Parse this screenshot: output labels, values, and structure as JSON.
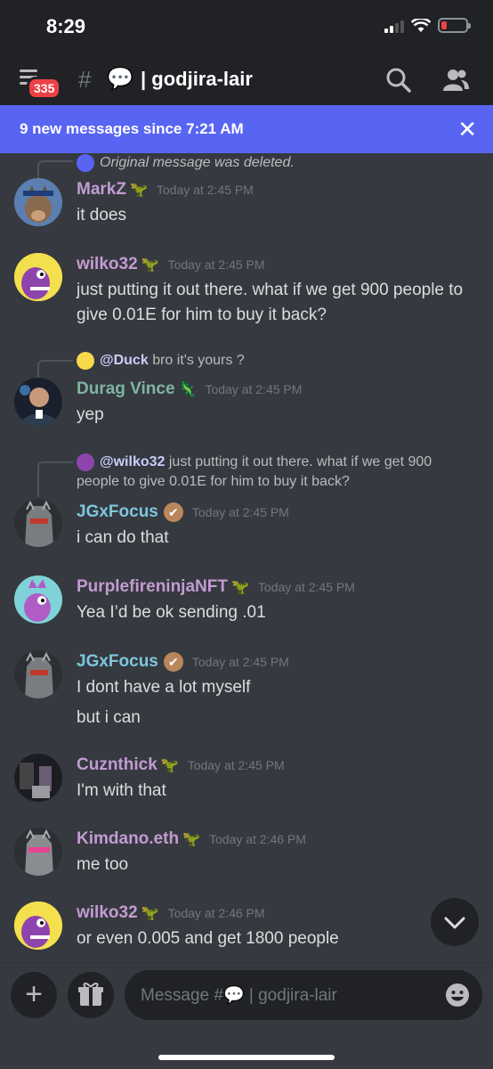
{
  "status": {
    "time": "8:29"
  },
  "header": {
    "badge": "335",
    "hash": "#",
    "channel_emoji": "💬",
    "channel": "| godjira-lair"
  },
  "banner": {
    "text": "9 new messages since 7:21 AM",
    "close": "✕"
  },
  "messages": [
    {
      "deleted": "Original message was deleted.",
      "author": "MarkZ",
      "author_color": "#c39bd3",
      "time": "Today at 2:45 PM",
      "lines": [
        "it does"
      ]
    },
    {
      "author": "wilko32",
      "author_color": "#c39bd3",
      "time": "Today at 2:45 PM",
      "lines": [
        "just putting it out there. what if we get 900 people to give 0.01E for him to buy it back?"
      ]
    },
    {
      "reply_to": "@Duck",
      "reply_text": "bro it's yours ?",
      "author": "Durag Vince",
      "author_color": "#7fb5a0",
      "time": "Today at 2:45 PM",
      "lines": [
        "yep"
      ]
    },
    {
      "reply_to": "@wilko32",
      "reply_text": "just putting it out there. what if we get 900 people to give 0.01E for him to buy it back?",
      "author": "JGxFocus",
      "author_color": "#7ec6e0",
      "time": "Today at 2:45 PM",
      "lines": [
        "i can do that"
      ]
    },
    {
      "author": "PurplefireninjaNFT",
      "author_color": "#c39bd3",
      "time": "Today at 2:45 PM",
      "lines": [
        "Yea I’d be ok sending .01"
      ]
    },
    {
      "author": "JGxFocus",
      "author_color": "#7ec6e0",
      "time": "Today at 2:45 PM",
      "lines": [
        "I dont have a lot myself",
        "but i can"
      ]
    },
    {
      "author": "Cuznthick",
      "author_color": "#c39bd3",
      "time": "Today at 2:45 PM",
      "lines": [
        "I'm with that"
      ]
    },
    {
      "author": "Kimdano.eth",
      "author_color": "#c39bd3",
      "time": "Today at 2:46 PM",
      "lines": [
        "me too"
      ]
    },
    {
      "author": "wilko32",
      "author_color": "#c39bd3",
      "time": "Today at 2:46 PM",
      "lines": [
        "or even 0.005 and get 1800 people"
      ]
    }
  ],
  "composer": {
    "placeholder_prefix": "Message #",
    "placeholder_emoji": "💬",
    "placeholder_channel": " | godjira-lair"
  }
}
